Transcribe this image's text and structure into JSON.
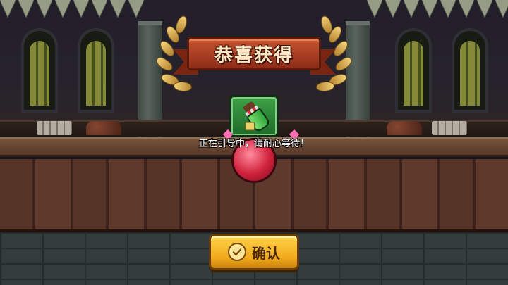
{
  "banner": {
    "title": "恭喜获得"
  },
  "reward": {
    "item_icon": "green-potion-icon",
    "orb_icon": "red-orb-icon"
  },
  "guide": {
    "text": "正在引导中，请耐心等待！"
  },
  "confirm": {
    "label": "确认",
    "icon": "check-icon"
  },
  "colors": {
    "banner": "#b3422a",
    "item_slot": "#2f8a3a",
    "button": "#f5b522",
    "orb": "#d0213b"
  }
}
